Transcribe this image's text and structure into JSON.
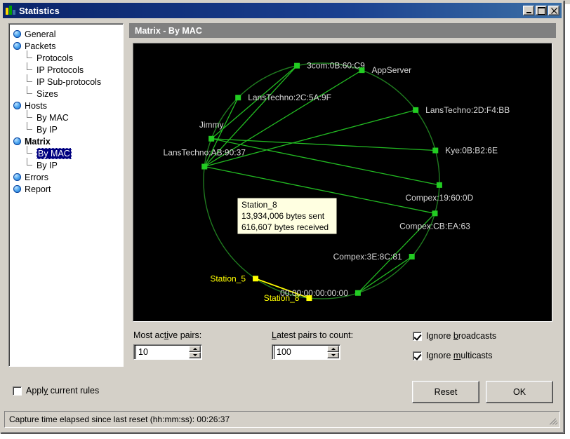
{
  "window": {
    "title": "Statistics",
    "icon": "bar-chart-icon",
    "minimize_label": "_",
    "maximize_label": "□",
    "close_label": "×"
  },
  "sidebar": {
    "items": [
      {
        "label": "General",
        "type": "root",
        "selected": false,
        "bold": false
      },
      {
        "label": "Packets",
        "type": "root",
        "selected": false,
        "bold": false
      },
      {
        "label": "Protocols",
        "type": "child",
        "selected": false,
        "bold": false
      },
      {
        "label": "IP Protocols",
        "type": "child",
        "selected": false,
        "bold": false
      },
      {
        "label": "IP Sub-protocols",
        "type": "child",
        "selected": false,
        "bold": false
      },
      {
        "label": "Sizes",
        "type": "child-last",
        "selected": false,
        "bold": false
      },
      {
        "label": "Hosts",
        "type": "root",
        "selected": false,
        "bold": false
      },
      {
        "label": "By MAC",
        "type": "child",
        "selected": false,
        "bold": false
      },
      {
        "label": "By IP",
        "type": "child-last",
        "selected": false,
        "bold": false
      },
      {
        "label": "Matrix",
        "type": "root",
        "selected": false,
        "bold": true
      },
      {
        "label": "By MAC",
        "type": "child",
        "selected": true,
        "bold": false
      },
      {
        "label": "By IP",
        "type": "child-last",
        "selected": false,
        "bold": false
      },
      {
        "label": "Errors",
        "type": "root",
        "selected": false,
        "bold": false
      },
      {
        "label": "Report",
        "type": "root",
        "selected": false,
        "bold": false
      }
    ]
  },
  "panel": {
    "header": "Matrix - By MAC"
  },
  "chart_data": {
    "type": "scatter",
    "title": "Matrix - By MAC",
    "layout": "circular node-link matrix",
    "background": "#000000",
    "node_color": "#22cc22",
    "highlight_color": "#ffff00",
    "edge_color": "#22bb22",
    "ring_color": "#1f7a1f",
    "nodes": [
      {
        "id": 0,
        "label": "LansTechno:AB:90:37",
        "angle_deg": 277,
        "highlight": false,
        "label_pos": "top"
      },
      {
        "id": 1,
        "label": "Jimmy",
        "angle_deg": 291,
        "highlight": false,
        "label_pos": "top"
      },
      {
        "id": 2,
        "label": "LansTechno:2C:5A:9F",
        "angle_deg": 315,
        "highlight": false,
        "label_pos": "right"
      },
      {
        "id": 3,
        "label": "3com:0B:60:C9",
        "angle_deg": 348,
        "highlight": false,
        "label_pos": "right"
      },
      {
        "id": 4,
        "label": "AppServer",
        "angle_deg": 20,
        "highlight": false,
        "label_pos": "right"
      },
      {
        "id": 5,
        "label": "LansTechno:2D:F4:BB",
        "angle_deg": 53,
        "highlight": false,
        "label_pos": "right"
      },
      {
        "id": 6,
        "label": "Kye:0B:B2:6E",
        "angle_deg": 75,
        "highlight": false,
        "label_pos": "right"
      },
      {
        "id": 7,
        "label": "Compex:19:60:0D",
        "angle_deg": 92,
        "highlight": false,
        "label_pos": "bottom"
      },
      {
        "id": 8,
        "label": "Compex:CB:EA:63",
        "angle_deg": 106,
        "highlight": false,
        "label_pos": "bottom"
      },
      {
        "id": 9,
        "label": "Compex:3E:8C:81",
        "angle_deg": 130,
        "highlight": false,
        "label_pos": "left"
      },
      {
        "id": 10,
        "label": "00:00:00:00:00:00",
        "angle_deg": 162,
        "highlight": false,
        "label_pos": "left"
      },
      {
        "id": 11,
        "label": "Station_8",
        "angle_deg": 186,
        "highlight": true,
        "label_pos": "left"
      },
      {
        "id": 12,
        "label": "Station_5",
        "angle_deg": 214,
        "highlight": true,
        "label_pos": "left"
      }
    ],
    "edges": [
      {
        "from": 0,
        "to": 2,
        "highlight": false
      },
      {
        "from": 0,
        "to": 3,
        "highlight": false
      },
      {
        "from": 0,
        "to": 4,
        "highlight": false
      },
      {
        "from": 0,
        "to": 5,
        "highlight": false
      },
      {
        "from": 0,
        "to": 8,
        "highlight": false
      },
      {
        "from": 1,
        "to": 7,
        "highlight": false
      },
      {
        "from": 1,
        "to": 6,
        "highlight": false
      },
      {
        "from": 1,
        "to": 3,
        "highlight": false
      },
      {
        "from": 10,
        "to": 9,
        "highlight": false
      },
      {
        "from": 10,
        "to": 8,
        "highlight": false
      },
      {
        "from": 11,
        "to": 12,
        "highlight": true
      }
    ],
    "tooltip": {
      "name": "Station_8",
      "sent": "13,934,006 bytes sent",
      "received": "616,607 bytes received"
    }
  },
  "controls": {
    "most_active_pairs": {
      "label_pre": "Most ac",
      "label_mnemonic": "ti",
      "label_post": "ve pairs:",
      "value": "10"
    },
    "latest_pairs": {
      "label_mnemonic": "L",
      "label_post": "atest pairs to count:",
      "value": "100"
    },
    "ignore_broadcasts": {
      "label_pre": "Ignore ",
      "label_mnemonic": "b",
      "label_post": "roadcasts",
      "checked": true
    },
    "ignore_multicasts": {
      "label_pre": "Ignore ",
      "label_mnemonic": "m",
      "label_post": "ulticasts",
      "checked": true
    }
  },
  "footer": {
    "apply_rules": {
      "label_pre": "Appl",
      "label_mnemonic": "y",
      "label_post": " current rules",
      "checked": false
    },
    "reset_label": "Reset",
    "ok_label": "OK",
    "status": "Capture time elapsed since last reset (hh:mm:ss): 00:26:37"
  }
}
